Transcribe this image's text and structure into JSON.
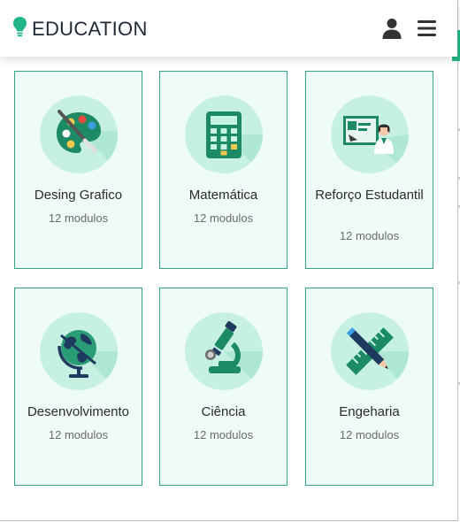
{
  "header": {
    "brand": "EDUCATION"
  },
  "icons": {
    "brand": "lightbulb-icon",
    "user": "user-icon",
    "menu": "hamburger-menu-icon"
  },
  "colors": {
    "accent": "#20b486",
    "card_border": "#2fa882",
    "card_bg": "#effbf8",
    "icon_circle": "#c6f1e2"
  },
  "courses": [
    {
      "title": "Desing Grafico",
      "modules": "12 modulos",
      "icon": "paint-palette-icon"
    },
    {
      "title": "Matemática",
      "modules": "12 modulos",
      "icon": "calculator-icon"
    },
    {
      "title": "Reforço Estudantil",
      "modules": "12 modulos",
      "icon": "teacher-board-icon"
    },
    {
      "title": "Desenvolvimento",
      "modules": "12 modulos",
      "icon": "globe-icon"
    },
    {
      "title": "Ciência",
      "modules": "12 modulos",
      "icon": "microscope-icon"
    },
    {
      "title": "Engeharia",
      "modules": "12 modulos",
      "icon": "ruler-pencil-icon"
    }
  ]
}
